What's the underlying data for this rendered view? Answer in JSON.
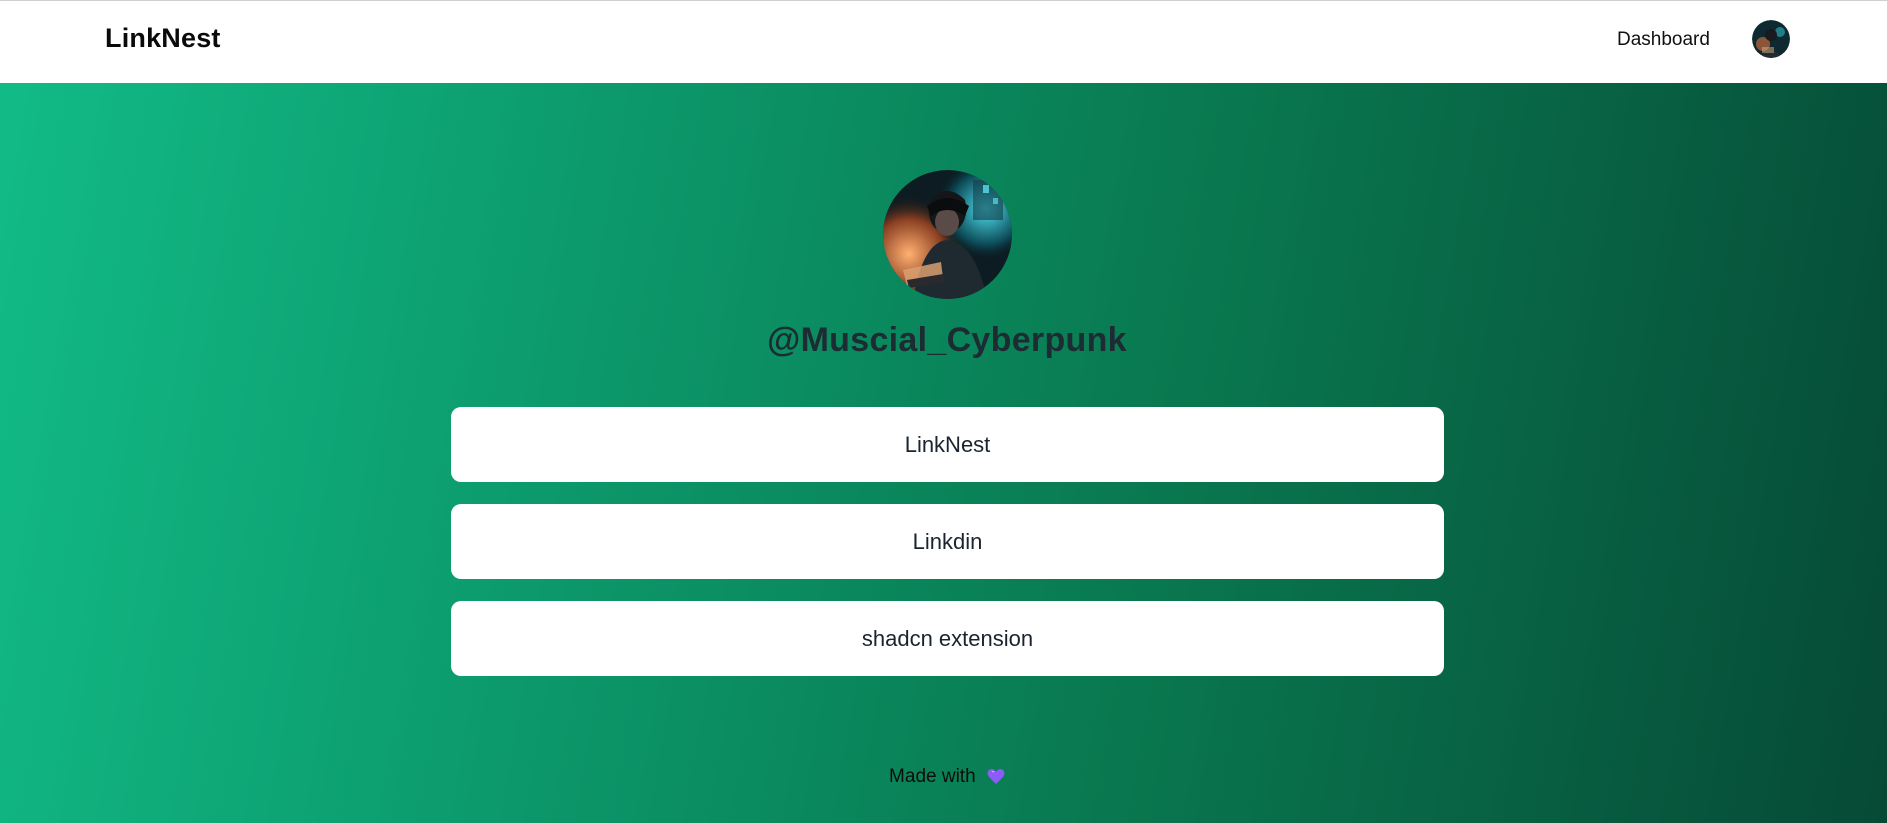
{
  "navbar": {
    "brand": "LinkNest",
    "dashboard_label": "Dashboard",
    "avatar_icon": "user-avatar"
  },
  "profile": {
    "avatar_icon": "profile-avatar-cyberpunk",
    "username": "@Muscial_Cyberpunk"
  },
  "links": [
    {
      "label": "LinkNest"
    },
    {
      "label": "Linkdin"
    },
    {
      "label": "shadcn extension"
    }
  ],
  "footer": {
    "made_with": "Made with",
    "heart_icon": "purple-heart-icon"
  },
  "colors": {
    "gradient_start": "#12bb86",
    "gradient_end": "#064a36",
    "heart": "#8b5cf6"
  }
}
